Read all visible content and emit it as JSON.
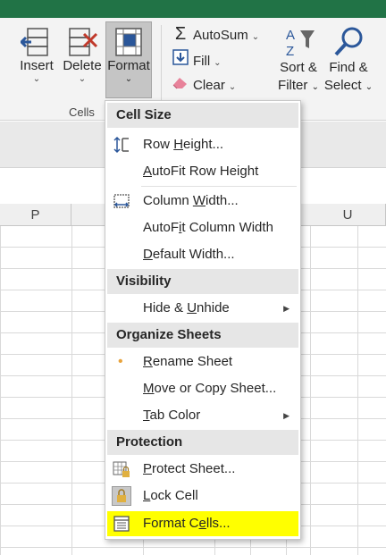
{
  "ribbon": {
    "cells_group": {
      "insert_label": "Insert",
      "delete_label": "Delete",
      "format_label": "Format",
      "group_label": "Cells"
    },
    "editing_group": {
      "autosum_label": "AutoSum",
      "fill_label": "Fill",
      "clear_label": "Clear",
      "sort_label_1": "Sort &",
      "sort_label_2": "Filter",
      "find_label_1": "Find &",
      "find_label_2": "Select"
    }
  },
  "columns": {
    "p": "P",
    "u": "U"
  },
  "format_menu": {
    "sections": {
      "cell_size": "Cell Size",
      "visibility": "Visibility",
      "organize_sheets": "Organize Sheets",
      "protection": "Protection"
    },
    "items": {
      "row_height": {
        "pre": "Row ",
        "u": "H",
        "post": "eight..."
      },
      "autofit_row_height": {
        "pre": "",
        "u": "A",
        "post": "utoFit Row Height"
      },
      "column_width": {
        "pre": "Column ",
        "u": "W",
        "post": "idth..."
      },
      "autofit_column_width": {
        "pre": "AutoF",
        "u": "i",
        "post": "t Column Width"
      },
      "default_width": {
        "pre": "",
        "u": "D",
        "post": "efault Width..."
      },
      "hide_unhide": {
        "pre": "Hide & ",
        "u": "U",
        "post": "nhide"
      },
      "rename_sheet": {
        "pre": "",
        "u": "R",
        "post": "ename Sheet"
      },
      "move_copy_sheet": {
        "pre": "",
        "u": "M",
        "post": "ove or Copy Sheet..."
      },
      "tab_color": {
        "pre": "",
        "u": "T",
        "post": "ab Color"
      },
      "protect_sheet": {
        "pre": "",
        "u": "P",
        "post": "rotect Sheet..."
      },
      "lock_cell": {
        "pre": "",
        "u": "L",
        "post": "ock Cell"
      },
      "format_cells": {
        "pre": "Format C",
        "u": "e",
        "post": "lls..."
      }
    }
  },
  "colors": {
    "title_bar": "#217346",
    "highlight": "#ffff00",
    "menu_section_bg": "#e6e6e6",
    "icon_blue": "#2b579a",
    "icon_red": "#c0392b"
  }
}
